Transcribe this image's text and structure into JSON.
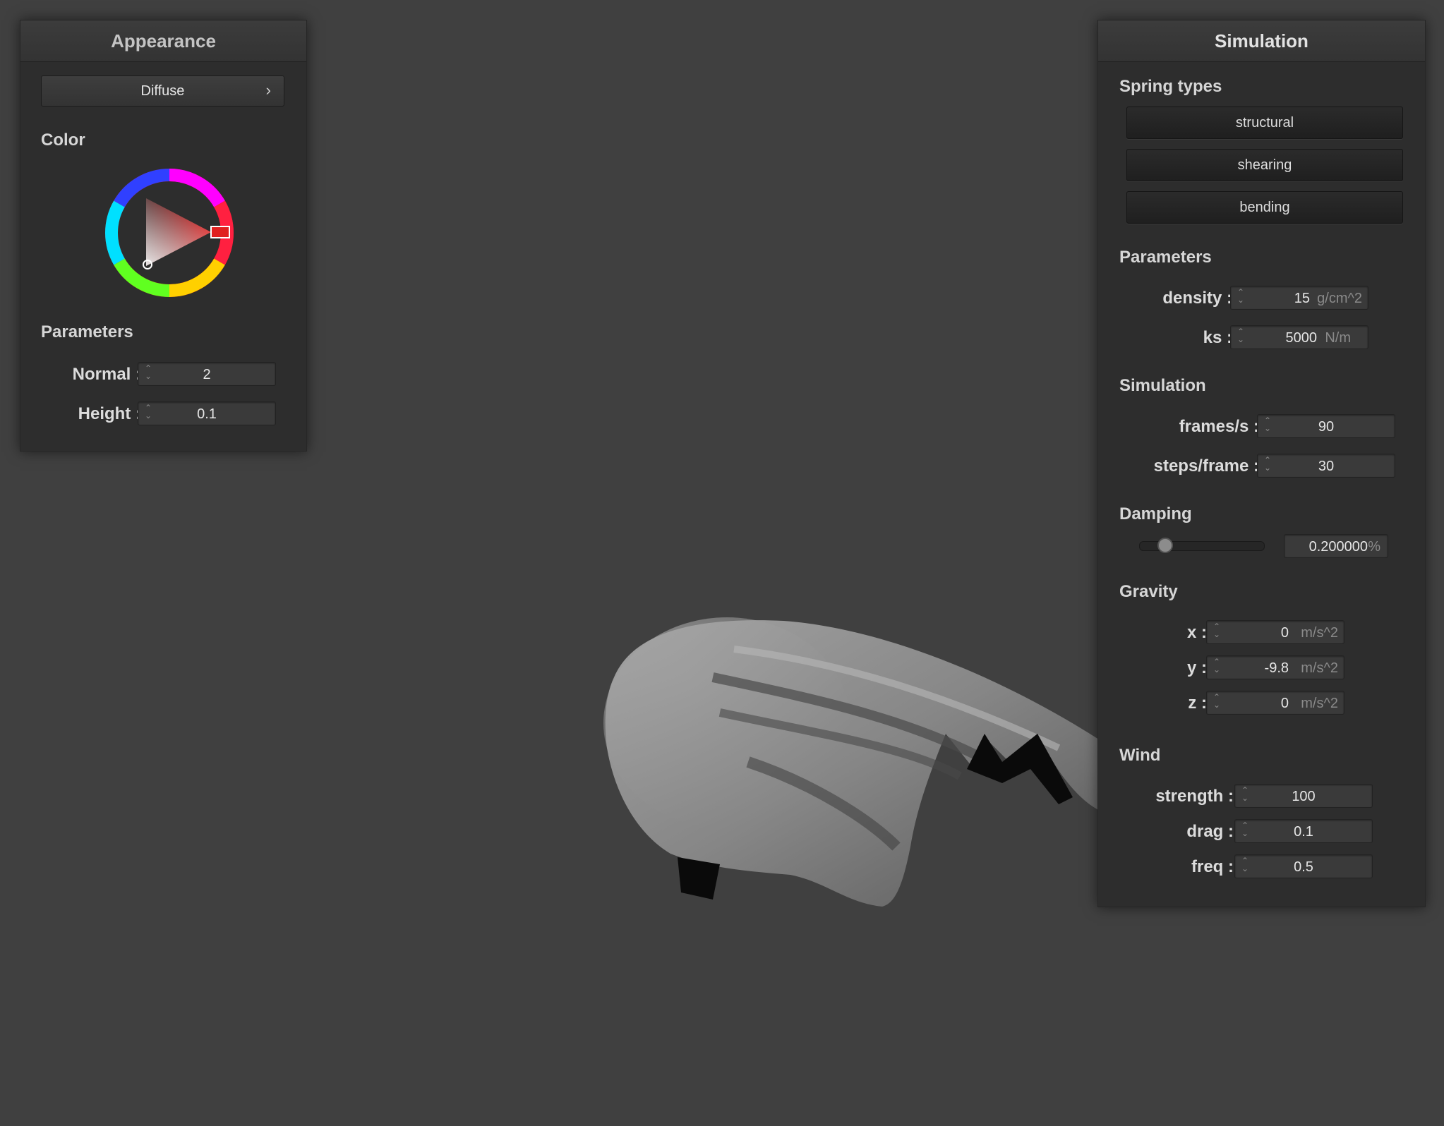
{
  "appearance": {
    "title": "Appearance",
    "shader_select": "Diffuse",
    "chevron_glyph": "›",
    "color_label": "Color",
    "selected_color": "#e02020",
    "parameters_label": "Parameters",
    "normal_label": "Normal :",
    "normal_value": "2",
    "height_label": "Height :",
    "height_value": "0.1"
  },
  "simulation": {
    "title": "Simulation",
    "spring_types_label": "Spring types",
    "spring_buttons": [
      "structural",
      "shearing",
      "bending"
    ],
    "parameters_label": "Parameters",
    "density_label": "density :",
    "density_value": "15",
    "density_unit": "g/cm^2",
    "ks_label": "ks :",
    "ks_value": "5000",
    "ks_unit": "N/m",
    "sim_label": "Simulation",
    "fps_label": "frames/s :",
    "fps_value": "90",
    "steps_label": "steps/frame :",
    "steps_value": "30",
    "damping_label": "Damping",
    "damping_value": "0.200000",
    "damping_unit": "%",
    "damping_level": 0.1,
    "gravity_label": "Gravity",
    "gx_label": "x :",
    "gx_value": "0",
    "gx_unit": "m/s^2",
    "gy_label": "y :",
    "gy_value": "-9.8",
    "gy_unit": "m/s^2",
    "gz_label": "z :",
    "gz_value": "0",
    "gz_unit": "m/s^2",
    "wind_label": "Wind",
    "strength_label": "strength :",
    "strength_value": "100",
    "drag_label": "drag :",
    "drag_value": "0.1",
    "freq_label": "freq :",
    "freq_value": "0.5"
  },
  "icons": {
    "stepper": "spinner-arrows-icon",
    "chevron": "chevron-right-icon"
  }
}
